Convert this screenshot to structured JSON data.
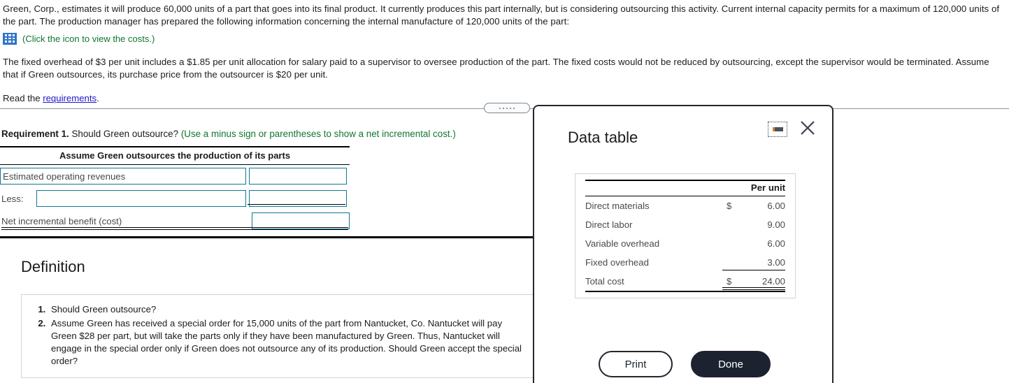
{
  "problem": {
    "paragraph1": "Green, Corp., estimates it will produce 60,000 units of a part that goes into its final product. It currently produces this part internally, but is considering outsourcing this activity. Current internal capacity permits for a maximum of 120,000 units of the part. The production manager has prepared the following information concerning the internal manufacture of 120,000 units of the part:",
    "icon_hint": "(Click the icon to view the costs.)",
    "icon_name": "spreadsheet-icon",
    "paragraph2": "The fixed overhead of $3 per unit includes a $1.85 per unit allocation for salary paid to a supervisor to oversee production of the part. The fixed costs would not be reduced by outsourcing, except the supervisor would be terminated. Assume that if Green outsources, its purchase price from the outsourcer is $20 per unit.",
    "read_prefix": "Read the ",
    "read_link": "requirements",
    "read_suffix": "."
  },
  "requirement": {
    "label": "Requirement 1.",
    "question": " Should Green outsource? ",
    "hint": "(Use a minus sign or parentheses to show a net incremental cost.)",
    "column_header": "Assume Green outsources the production of its parts",
    "rows": [
      {
        "label": "Estimated operating revenues",
        "label_value": "Estimated operating revenues",
        "amount": "",
        "editable_label": true
      },
      {
        "label": "Less:",
        "label_value": "",
        "amount": ""
      },
      {
        "label": "Net incremental benefit (cost)",
        "label_value": "",
        "amount": ""
      }
    ]
  },
  "definition": {
    "title": "Definition",
    "items": [
      "Should Green outsource?",
      "Assume Green has received a special order for 15,000 units of the part from Nantucket, Co. Nantucket will pay Green $28 per part, but will take the parts only if they have been manufactured by Green. Thus, Nantucket will engage in the special order only if Green does not outsource any of its production. Should Green accept the special order?"
    ]
  },
  "dialog": {
    "title": "Data table",
    "minimize_label": "minimize",
    "close_label": "close",
    "table": {
      "column_header": "Per unit",
      "rows": [
        {
          "label": "Direct materials",
          "currency": "$",
          "value": "6.00"
        },
        {
          "label": "Direct labor",
          "currency": "",
          "value": "9.00"
        },
        {
          "label": "Variable overhead",
          "currency": "",
          "value": "6.00"
        },
        {
          "label": "Fixed overhead",
          "currency": "",
          "value": "3.00"
        },
        {
          "label": "Total cost",
          "currency": "$",
          "value": "24.00"
        }
      ]
    },
    "buttons": {
      "print": "Print",
      "done": "Done"
    }
  },
  "colors": {
    "hint_green": "#11762f",
    "link_blue": "#2018c8",
    "input_border_teal": "#0c7a93",
    "dialog_border": "#22262e",
    "done_button": "#1c2230",
    "icon_blue": "#2e74c8"
  }
}
